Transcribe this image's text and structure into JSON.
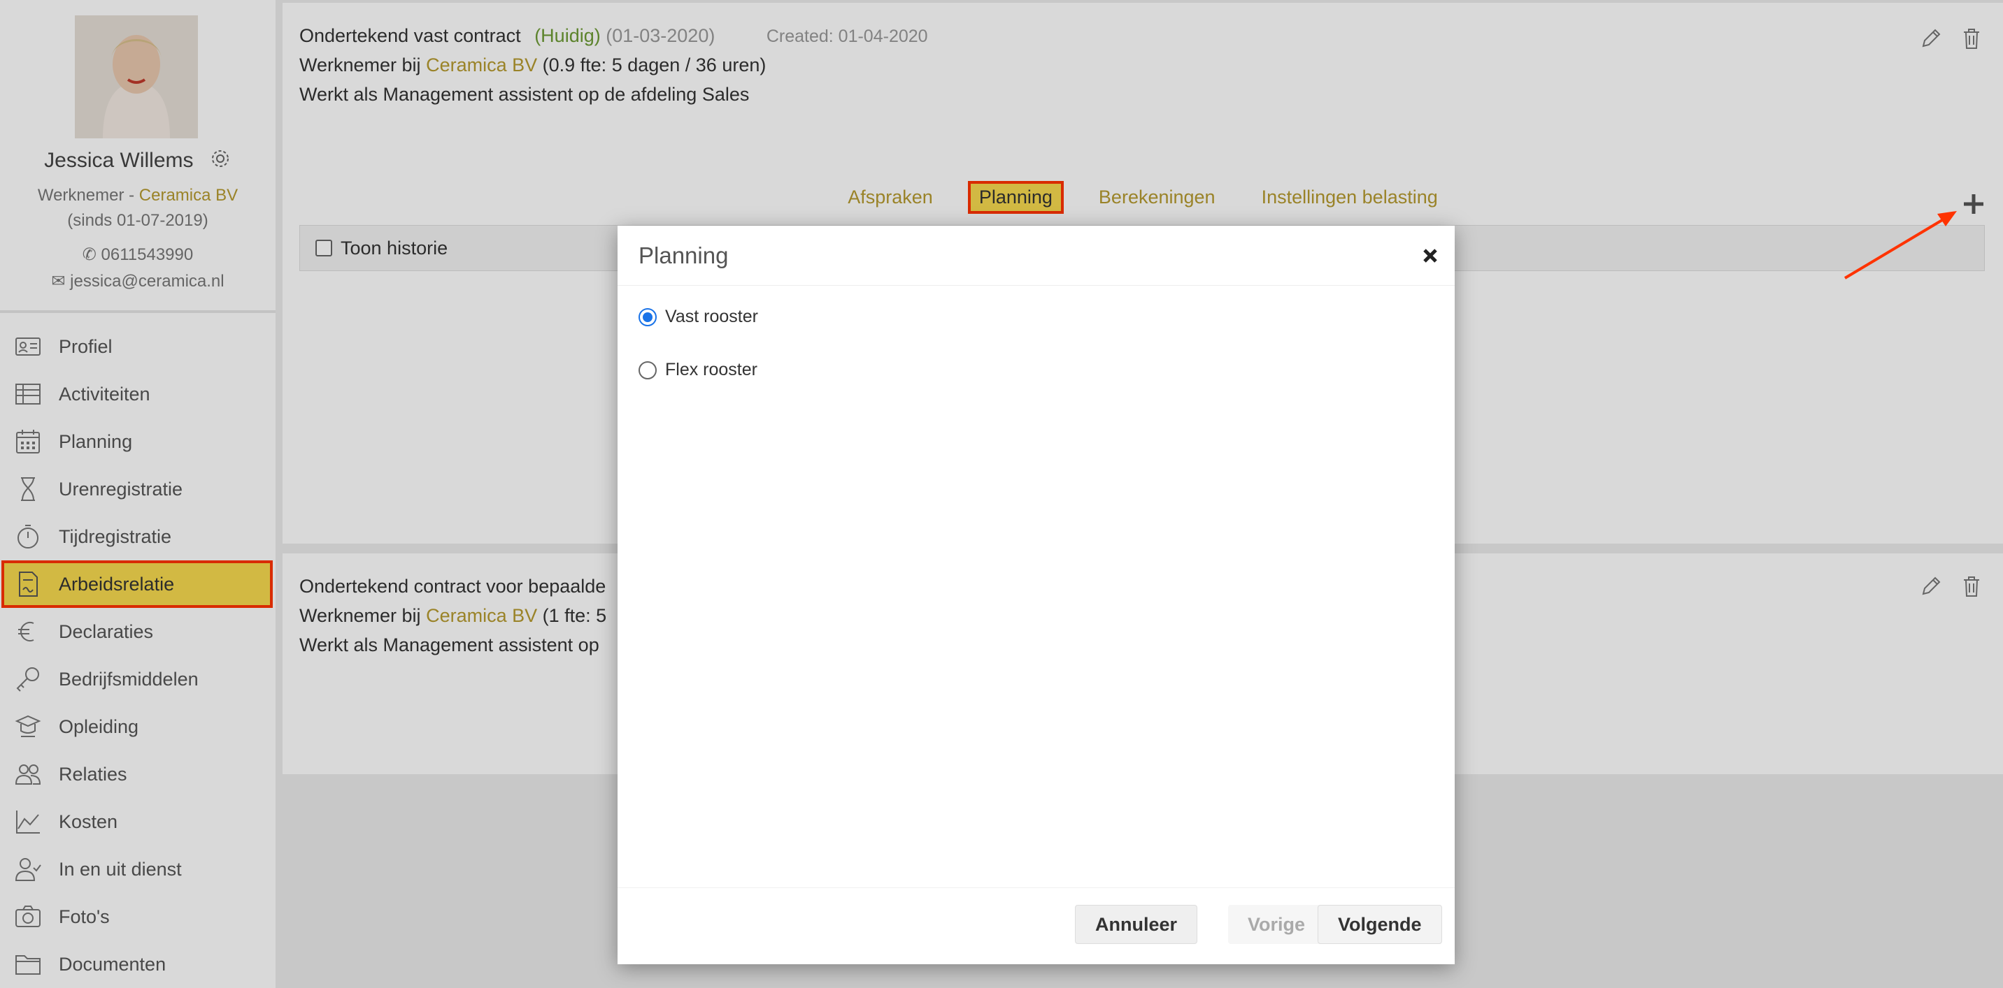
{
  "profile": {
    "name": "Jessica Willems",
    "role_prefix": "Werknemer - ",
    "company": "Ceramica BV",
    "since": "(sinds 01-07-2019)",
    "phone": "0611543990",
    "email": "jessica@ceramica.nl"
  },
  "sidebar": {
    "items": [
      {
        "label": "Profiel",
        "icon": "id-card-icon"
      },
      {
        "label": "Activiteiten",
        "icon": "table-icon"
      },
      {
        "label": "Planning",
        "icon": "calendar-icon"
      },
      {
        "label": "Urenregistratie",
        "icon": "hourglass-icon"
      },
      {
        "label": "Tijdregistratie",
        "icon": "stopwatch-icon"
      },
      {
        "label": "Arbeidsrelatie",
        "icon": "contract-icon",
        "active": true
      },
      {
        "label": "Declaraties",
        "icon": "euro-icon"
      },
      {
        "label": "Bedrijfsmiddelen",
        "icon": "key-icon"
      },
      {
        "label": "Opleiding",
        "icon": "graduation-icon"
      },
      {
        "label": "Relaties",
        "icon": "users-icon"
      },
      {
        "label": "Kosten",
        "icon": "chart-icon"
      },
      {
        "label": "In en uit dienst",
        "icon": "user-check-icon"
      },
      {
        "label": "Foto's",
        "icon": "camera-icon"
      },
      {
        "label": "Documenten",
        "icon": "folder-icon"
      }
    ]
  },
  "contract1": {
    "title": "Ondertekend vast contract",
    "status": "(Huidig)",
    "date": "(01-03-2020)",
    "created": "Created: 01-04-2020",
    "employee_prefix": "Werknemer bij",
    "company": "Ceramica BV",
    "fte": "(0.9 fte: 5 dagen / 36 uren)",
    "works_as": "Werkt als Management assistent op de afdeling Sales"
  },
  "tabs": [
    "Afspraken",
    "Planning",
    "Berekeningen",
    "Instellingen belasting"
  ],
  "active_tab": "Planning",
  "historie_label": "Toon historie",
  "contract2": {
    "title": "Ondertekend contract voor bepaalde",
    "employee_prefix": "Werknemer bij",
    "company": "Ceramica BV",
    "fte": "(1 fte: 5",
    "works_as": "Werkt als Management assistent op"
  },
  "modal": {
    "title": "Planning",
    "options": [
      "Vast rooster",
      "Flex rooster"
    ],
    "selected": "Vast rooster",
    "cancel": "Annuleer",
    "prev": "Vorige",
    "next": "Volgende"
  },
  "colors": {
    "accent_gold": "#b69a2f",
    "highlight_yellow": "#f7da4f",
    "annotation_red": "#ff3300",
    "status_green": "#6d9a34",
    "radio_blue": "#1a73e8"
  }
}
